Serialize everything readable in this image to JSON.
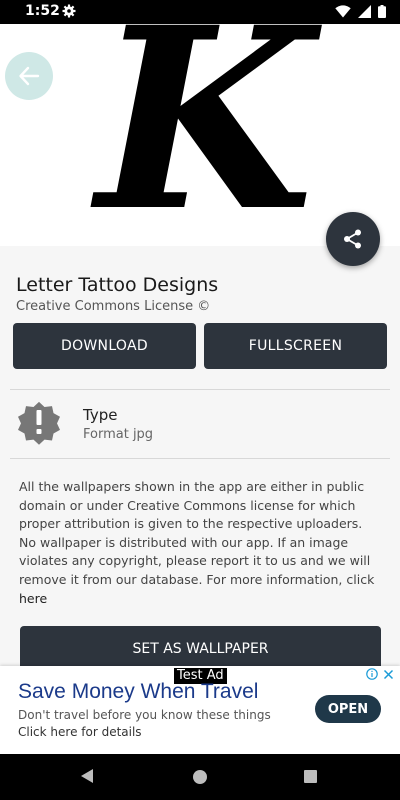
{
  "status_bar": {
    "time": "1:52",
    "icons": [
      "gear-icon",
      "wifi-icon",
      "signal-icon",
      "battery-icon"
    ]
  },
  "hero": {
    "glyph": "K",
    "back_icon": "arrow-left-icon",
    "share_icon": "share-icon"
  },
  "detail": {
    "title": "Letter Tattoo Designs",
    "license": "Creative Commons License ©",
    "download_label": "DOWNLOAD",
    "fullscreen_label": "FULLSCREEN",
    "type_icon": "alert-badge-icon",
    "type_label": "Type",
    "type_value": "Format jpg",
    "info_text": "All the wallpapers shown in the app are either in public domain or under Creative Commons license for which proper attribution is given to the respective uploaders. No wallpaper is distributed with our app. If an image violates any copyright, please report it to us and we will remove it from our database. For more information, click ",
    "info_link": "here",
    "set_wallpaper_label": "SET AS WALLPAPER"
  },
  "ad": {
    "tag": "Test Ad",
    "title": "Save Money When Travel",
    "text1": "Don't travel before you know these things",
    "text2": "Click here for details",
    "open_label": "OPEN",
    "choices_icons": [
      "info-icon",
      "close-icon"
    ]
  },
  "nav_bar": {
    "icons": [
      "back-icon",
      "home-icon",
      "recents-icon"
    ]
  },
  "colors": {
    "button_dark": "#2d343d",
    "back_button_bg": "#cfe8e6",
    "ad_title": "#1b3a8a",
    "ad_open_bg": "#1f3849"
  }
}
